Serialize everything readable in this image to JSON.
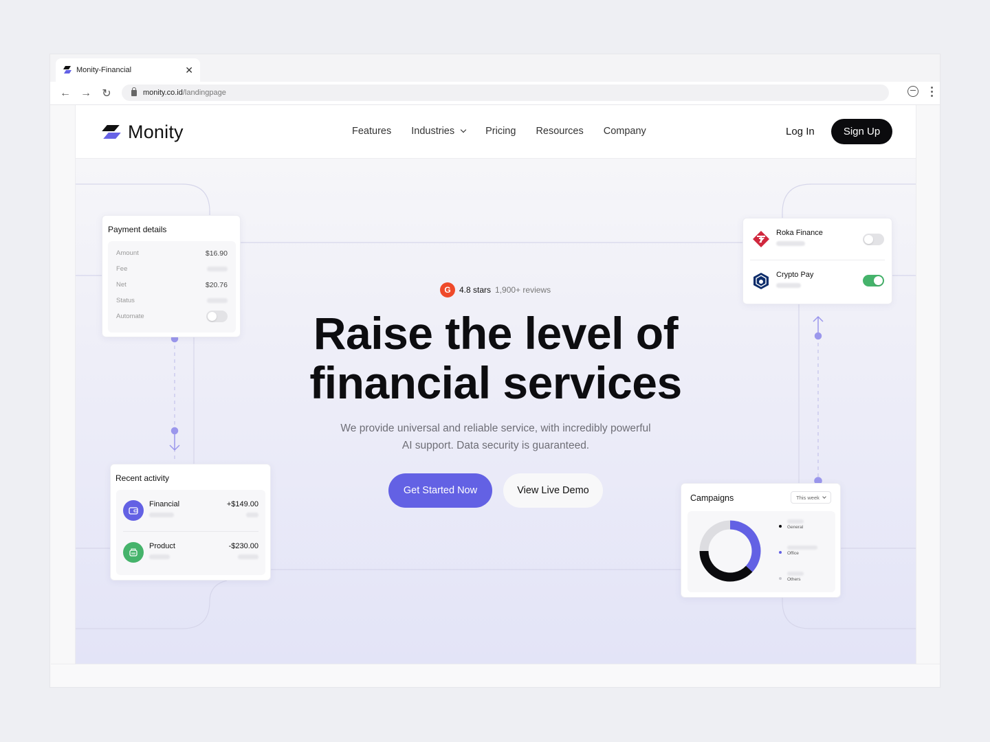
{
  "browser": {
    "tab_title": "Monity-Financial",
    "url_host": "monity.co.id",
    "url_path": "/landingpage",
    "icons": [
      "back-arrow",
      "forward-arrow",
      "reload",
      "lock",
      "extension",
      "menu-kebab"
    ]
  },
  "header": {
    "logo_text": "Monity",
    "nav": [
      {
        "label": "Features",
        "has_dropdown": false
      },
      {
        "label": "Industries",
        "has_dropdown": true
      },
      {
        "label": "Pricing",
        "has_dropdown": false
      },
      {
        "label": "Resources",
        "has_dropdown": false
      },
      {
        "label": "Company",
        "has_dropdown": false
      }
    ],
    "login_label": "Log In",
    "signup_label": "Sign Up"
  },
  "hero": {
    "rating_badge": "G",
    "rating_stars": "4.8 stars",
    "rating_reviews": "1,900+ reviews",
    "headline_line1": "Raise the level of",
    "headline_line2": "financial services",
    "subtitle_line1": "We provide universal and reliable service, with incredibly powerful",
    "subtitle_line2": "AI support. Data security is guaranteed.",
    "primary_cta": "Get Started Now",
    "secondary_cta": "View Live Demo"
  },
  "payment_card": {
    "title": "Payment details",
    "rows": [
      {
        "label": "Amount",
        "value": "$16.90"
      },
      {
        "label": "Fee",
        "value": null
      },
      {
        "label": "Net",
        "value": "$20.76"
      },
      {
        "label": "Status",
        "value": null
      }
    ],
    "automate_label": "Automate",
    "automate_on": false
  },
  "recent_card": {
    "title": "Recent activity",
    "items": [
      {
        "name": "Financial",
        "amount": "+$149.00",
        "icon": "wallet-icon",
        "color": "#6361e4"
      },
      {
        "name": "Product",
        "amount": "-$230.00",
        "icon": "basket-icon",
        "color": "#45b36b"
      }
    ]
  },
  "integrations_card": {
    "items": [
      {
        "name": "Roka Finance",
        "enabled": false,
        "color": "#d0283e"
      },
      {
        "name": "Crypto Pay",
        "enabled": true,
        "color": "#0d2d6b"
      }
    ]
  },
  "campaigns_card": {
    "title": "Campaigns",
    "period": "This week",
    "legend": [
      {
        "label": "General",
        "color": "#0b0b0e"
      },
      {
        "label": "Office",
        "color": "#6361e4"
      },
      {
        "label": "Others",
        "color": "#c9c9cf"
      }
    ]
  },
  "chart_data": {
    "type": "pie",
    "title": "Campaigns",
    "donut": true,
    "categories": [
      "Office",
      "General",
      "Others"
    ],
    "values": [
      37,
      38,
      25
    ],
    "colors": [
      "#6361e4",
      "#0b0b0e",
      "#dddde1"
    ],
    "start_angle_deg": 0
  },
  "colors": {
    "accent": "#6361e4",
    "success": "#45b36b",
    "dark": "#0b0b0e"
  }
}
